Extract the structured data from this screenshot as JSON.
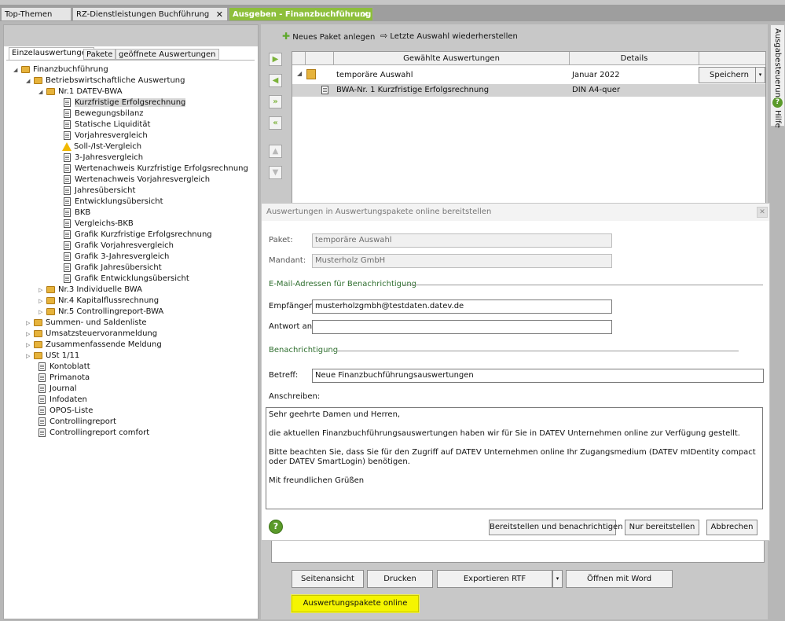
{
  "tabs": [
    {
      "label": "Top-Themen"
    },
    {
      "label": "RZ-Dienstleistungen Buchführung",
      "close": "✕"
    },
    {
      "label": "Ausgeben - Finanzbuchführung",
      "close": "✕"
    }
  ],
  "left_panel": {
    "subtabs": [
      "Einzelauswertungen",
      "Pakete",
      "geöffnete Auswertungen"
    ],
    "tree": [
      {
        "label": "Finanzbuchführung"
      },
      {
        "label": "Betriebswirtschaftliche Auswertung"
      },
      {
        "label": "Nr.1 DATEV-BWA"
      },
      {
        "label": "Kurzfristige Erfolgsrechnung"
      },
      {
        "label": "Bewegungsbilanz"
      },
      {
        "label": "Statische Liquidität"
      },
      {
        "label": "Vorjahresvergleich"
      },
      {
        "label": "Soll-/Ist-Vergleich"
      },
      {
        "label": "3-Jahresvergleich"
      },
      {
        "label": "Wertenachweis Kurzfristige Erfolgsrechnung"
      },
      {
        "label": "Wertenachweis Vorjahresvergleich"
      },
      {
        "label": "Jahresübersicht"
      },
      {
        "label": "Entwicklungsübersicht"
      },
      {
        "label": "BKB"
      },
      {
        "label": "Vergleichs-BKB"
      },
      {
        "label": "Grafik Kurzfristige Erfolgsrechnung"
      },
      {
        "label": "Grafik Vorjahresvergleich"
      },
      {
        "label": "Grafik 3-Jahresvergleich"
      },
      {
        "label": "Grafik Jahresübersicht"
      },
      {
        "label": "Grafik Entwicklungsübersicht"
      },
      {
        "label": "Nr.3 Individuelle BWA"
      },
      {
        "label": "Nr.4 Kapitalflussrechnung"
      },
      {
        "label": "Nr.5 Controllingreport-BWA"
      },
      {
        "label": "Summen- und Saldenliste"
      },
      {
        "label": "Umsatzsteuervoranmeldung"
      },
      {
        "label": "Zusammenfassende Meldung"
      },
      {
        "label": "USt 1/11"
      },
      {
        "label": "Kontoblatt"
      },
      {
        "label": "Primanota"
      },
      {
        "label": "Journal"
      },
      {
        "label": "Infodaten"
      },
      {
        "label": "OPOS-Liste"
      },
      {
        "label": "Controllingreport"
      },
      {
        "label": "Controllingreport comfort"
      }
    ]
  },
  "toolbar": {
    "new_package": "Neues Paket anlegen",
    "restore": "Letzte Auswahl wiederherstellen"
  },
  "grid": {
    "col_selected": "Gewählte Auswertungen",
    "col_details": "Details",
    "row1_name": "temporäre Auswahl",
    "row1_details": "Januar 2022",
    "save_button": "Speichern",
    "row2_name": "BWA-Nr. 1 Kurzfristige Erfolgsrechnung",
    "row2_details": "DIN A4-quer"
  },
  "dialog": {
    "title": "Auswertungen in Auswertungspakete online bereitstellen",
    "paket_label": "Paket:",
    "paket_value": "temporäre Auswahl",
    "mandant_label": "Mandant:",
    "mandant_value": "Musterholz GmbH",
    "email_section": "E-Mail-Adressen für Benachrichtigung",
    "empfaenger_label": "Empfänger:",
    "empfaenger_value": "musterholzgmbh@testdaten.datev.de",
    "antwort_label": "Antwort an:",
    "antwort_value": "",
    "notify_section": "Benachrichtigung",
    "betreff_label": "Betreff:",
    "betreff_value": "Neue Finanzbuchführungsauswertungen",
    "anschreiben_label": "Anschreiben:",
    "letter": {
      "line1": "Sehr geehrte Damen und Herren,",
      "line2": "die aktuellen Finanzbuchführungsauswertungen haben wir für Sie in DATEV Unternehmen online zur Verfügung gestellt.",
      "line3": "Bitte beachten Sie, dass Sie für den Zugriff auf DATEV Unternehmen online Ihr Zugangsmedium (DATEV mIDentity compact oder DATEV SmartLogin) benötigen.",
      "line4": "Mit freundlichen Grüßen"
    },
    "help": "?",
    "btn_provide_notify": "Bereitstellen und benachrichtigen",
    "btn_provide": "Nur bereitstellen",
    "btn_cancel": "Abbrechen"
  },
  "bottom": {
    "page_view": "Seitenansicht",
    "print": "Drucken",
    "export_rtf": "Exportieren RTF",
    "open_word": "Öffnen mit Word",
    "packages_online": "Auswertungspakete online"
  },
  "side": {
    "output_control": "Ausgabesteuerung",
    "help": "Hilfe",
    "help_icon": "?"
  }
}
